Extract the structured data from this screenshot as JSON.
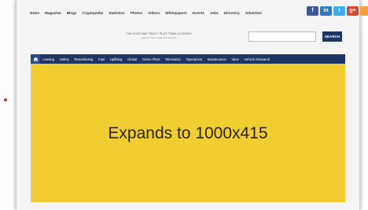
{
  "top_nav": [
    "News",
    "Magazine",
    "Blogs",
    "Cryptopedia",
    "Statistics",
    "Photos",
    "Videos",
    "Whitepapers",
    "Events",
    "Jobs",
    "Directory",
    "Advertise"
  ],
  "social": [
    {
      "name": "facebook",
      "glyph": "f",
      "color": "#3b5998"
    },
    {
      "name": "linkedin",
      "glyph": "in",
      "color": "#2a7cc0"
    },
    {
      "name": "twitter",
      "glyph": "t",
      "color": "#3eaee6"
    },
    {
      "name": "google-plus",
      "glyph": "g+",
      "color": "#d6492f"
    },
    {
      "name": "rss",
      "glyph": "",
      "color": "#f2a33a"
    }
  ],
  "header": {
    "tagline": "THE EVIE AND TRACY PLOT TWIN LEGENDS",
    "tagline_sub": "cryptocurrency news and analysis"
  },
  "search": {
    "placeholder": "",
    "button_label": "SEARCH"
  },
  "main_nav": [
    "Leasing",
    "Safety",
    "Remarketing",
    "Fuel",
    "Upfitting",
    "Global",
    "Green Fleet",
    "Telematics",
    "Operations",
    "Maintenance",
    "Vans",
    "Vehicle Research"
  ],
  "ad": {
    "text": "Expands to 1000x415"
  },
  "colors": {
    "nav_bg": "#1e3563",
    "ad_bg": "#f2cd32"
  }
}
